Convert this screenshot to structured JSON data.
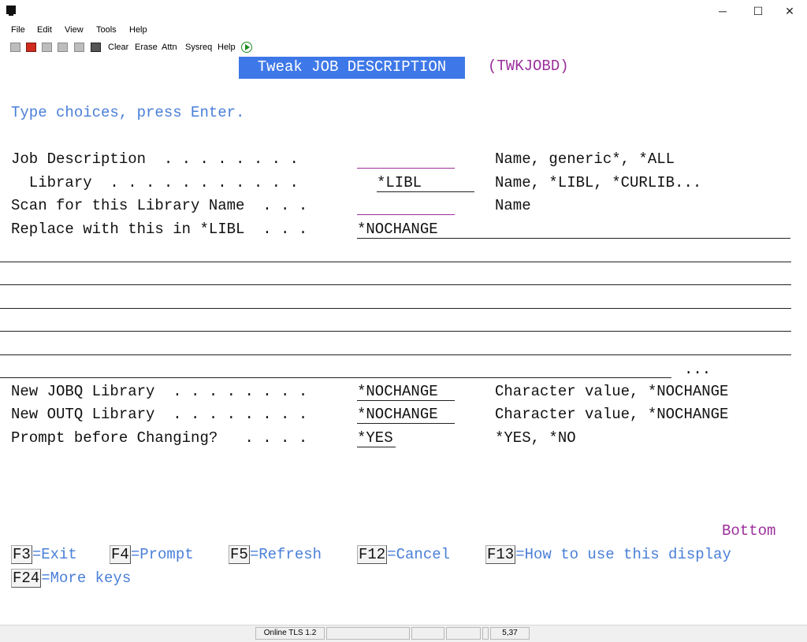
{
  "window": {
    "minimize_glyph": "─",
    "maximize_glyph": "☐",
    "close_glyph": "✕"
  },
  "menu": [
    "File",
    "Edit",
    "View",
    "Tools",
    "Help"
  ],
  "toolbar": {
    "icons": [
      "printer-icon",
      "flag-icon",
      "copy-icon",
      "paste-icon",
      "print-icon",
      "record-icon"
    ],
    "labels": [
      "Clear",
      "Erase",
      "Attn",
      "Sysreq",
      "Help"
    ]
  },
  "screen": {
    "title": "Tweak JOB DESCRIPTION",
    "program": "(TWKJOBD)",
    "instruction": "Type choices, press Enter.",
    "fields": [
      {
        "label": "Job Description  . . . . . . . .",
        "value": "",
        "hint": "Name, generic*, *ALL"
      },
      {
        "label": "  Library  . . . . . . . . . . .",
        "value": "*LIBL",
        "hint": "Name, *LIBL, *CURLIB..."
      },
      {
        "label": "Scan for this Library Name  . . .",
        "value": "",
        "hint": "Name"
      },
      {
        "label": "Replace with this in *LIBL  . . .",
        "value": "*NOCHANGE",
        "hint": ""
      }
    ],
    "ellipsis": "...",
    "fields2": [
      {
        "label": "New JOBQ Library  . . . . . . . .",
        "value": "*NOCHANGE",
        "hint": "Character value, *NOCHANGE"
      },
      {
        "label": "New OUTQ Library  . . . . . . . .",
        "value": "*NOCHANGE",
        "hint": "Character value, *NOCHANGE"
      },
      {
        "label": "Prompt before Changing?   . . . .",
        "value": "*YES",
        "hint": "*YES, *NO"
      }
    ],
    "bottom": "Bottom",
    "fkeys": [
      {
        "key": "F3",
        "text": "=Exit"
      },
      {
        "key": "F4",
        "text": "=Prompt"
      },
      {
        "key": "F5",
        "text": "=Refresh"
      },
      {
        "key": "F12",
        "text": "=Cancel"
      },
      {
        "key": "F13",
        "text": "=How to use this display"
      },
      {
        "key": "F24",
        "text": "=More keys"
      }
    ]
  },
  "status": {
    "connection": "Online TLS 1.2",
    "cursor": "5,37"
  }
}
